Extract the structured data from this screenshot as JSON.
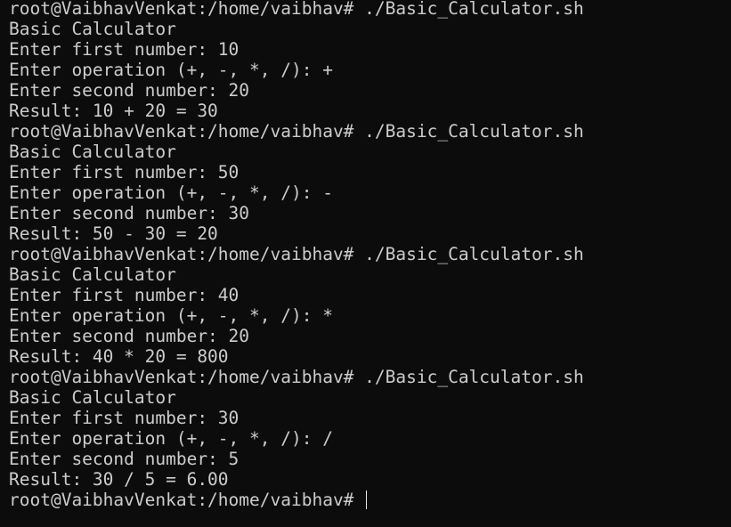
{
  "terminal": {
    "colors": {
      "background": "#0c0c0c",
      "foreground": "#cccccc",
      "cursor": "#e6e6e6"
    },
    "lines": [
      "root@VaibhavVenkat:/home/vaibhav# ./Basic_Calculator.sh",
      "Basic Calculator",
      "Enter first number: 10",
      "Enter operation (+, -, *, /): +",
      "Enter second number: 20",
      "Result: 10 + 20 = 30",
      "root@VaibhavVenkat:/home/vaibhav# ./Basic_Calculator.sh",
      "Basic Calculator",
      "Enter first number: 50",
      "Enter operation (+, -, *, /): -",
      "Enter second number: 30",
      "Result: 50 - 30 = 20",
      "root@VaibhavVenkat:/home/vaibhav# ./Basic_Calculator.sh",
      "Basic Calculator",
      "Enter first number: 40",
      "Enter operation (+, -, *, /): *",
      "Enter second number: 20",
      "Result: 40 * 20 = 800",
      "root@VaibhavVenkat:/home/vaibhav# ./Basic_Calculator.sh",
      "Basic Calculator",
      "Enter first number: 30",
      "Enter operation (+, -, *, /): /",
      "Enter second number: 5",
      "Result: 30 / 5 = 6.00"
    ],
    "prompt": "root@VaibhavVenkat:/home/vaibhav# "
  }
}
